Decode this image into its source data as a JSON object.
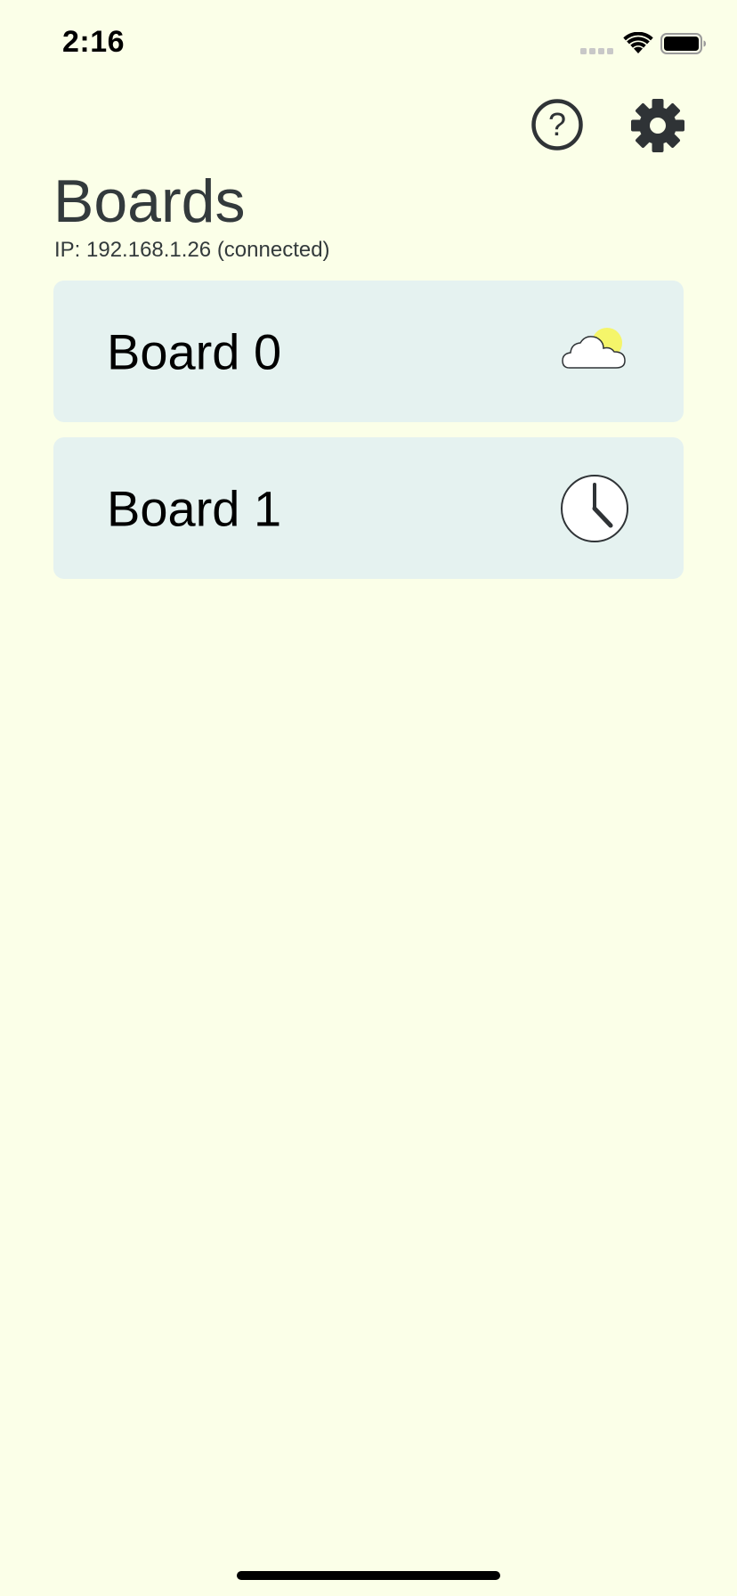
{
  "status_bar": {
    "time": "2:16"
  },
  "header": {
    "help_icon": "help-circle-icon",
    "settings_icon": "gear-icon",
    "title": "Boards",
    "connection_status": "IP: 192.168.1.26 (connected)"
  },
  "boards": [
    {
      "label": "Board 0",
      "icon": "partly-cloudy-icon"
    },
    {
      "label": "Board 1",
      "icon": "clock-icon"
    }
  ],
  "colors": {
    "background": "#fbffe8",
    "card": "#e5f2f0",
    "text_dark": "#333a3c",
    "sun": "#f5f56a"
  }
}
